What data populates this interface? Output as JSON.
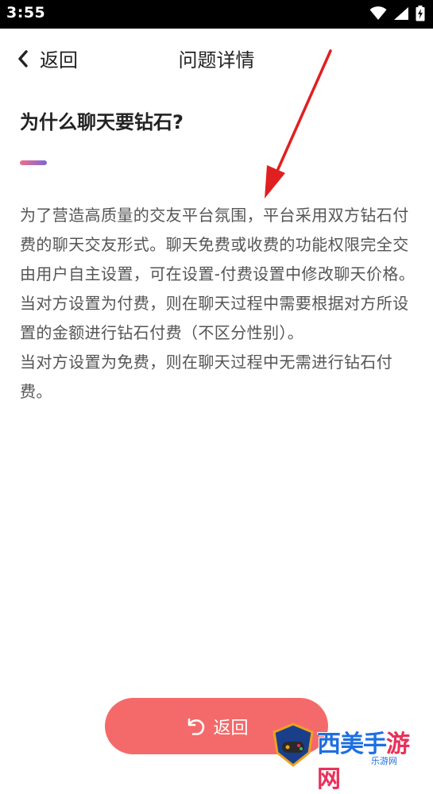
{
  "status_bar": {
    "time": "3:55"
  },
  "nav": {
    "back_label": "返回",
    "title": "问题详情"
  },
  "question": {
    "title": "为什么聊天要钻石?"
  },
  "answer": {
    "paragraphs": [
      "为了营造高质量的交友平台氛围，平台采用双方钻石付费的聊天交友形式。聊天免费或收费的功能权限完全交由用户自主设置，可在设置-付费设置中修改聊天价格。",
      "当对方设置为付费，则在聊天过程中需要根据对方所设置的金额进行钻石付费（不区分性别）。",
      "当对方设置为免费，则在聊天过程中无需进行钻石付费。"
    ]
  },
  "bottom_button": {
    "label": "返回"
  },
  "watermark": {
    "main_part1": "西美手",
    "main_part2": "游网",
    "sub": "乐游网"
  },
  "colors": {
    "accent_button": "#f46a6a",
    "annotation_arrow": "#e02020",
    "title_accent_start": "#f06e8a",
    "title_accent_end": "#7b68d6"
  },
  "icons": {
    "wifi": "wifi-icon",
    "signal": "signal-icon",
    "battery": "battery-charging-icon",
    "back": "chevron-left-icon",
    "undo": "undo-arrow-icon"
  }
}
